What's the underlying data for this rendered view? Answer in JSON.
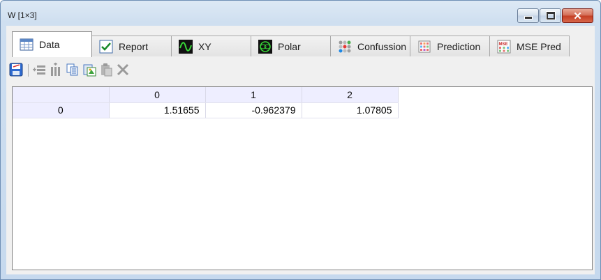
{
  "window": {
    "title": "W [1×3]"
  },
  "tabs": [
    {
      "label": "Data",
      "icon": "table-icon"
    },
    {
      "label": "Report",
      "icon": "checkmark-icon"
    },
    {
      "label": "XY",
      "icon": "wave-icon"
    },
    {
      "label": "Polar",
      "icon": "polar-icon"
    },
    {
      "label": "Confussion",
      "icon": "dots-matrix-icon"
    },
    {
      "label": "Prediction",
      "icon": "grid-icon"
    },
    {
      "label": "MSE Pred",
      "icon": "mse-icon"
    }
  ],
  "active_tab": "Data",
  "toolbar": [
    "save-icon",
    "insert-row-icon",
    "insert-column-icon",
    "copy-icon",
    "paste-special-icon",
    "paste-icon",
    "delete-icon"
  ],
  "grid": {
    "columns": [
      "0",
      "1",
      "2"
    ],
    "rows": [
      {
        "header": "0",
        "cells": [
          "1.51655",
          "-0.962379",
          "1.07805"
        ]
      }
    ]
  }
}
